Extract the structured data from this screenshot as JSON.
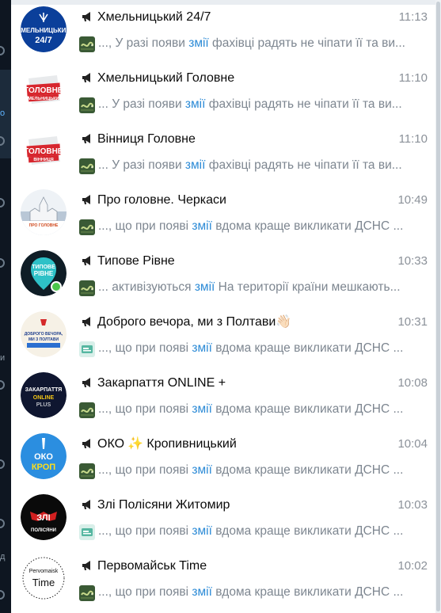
{
  "left_nav": {
    "fragments": [
      "o",
      "и",
      "д"
    ]
  },
  "chats": [
    {
      "title": "Хмельницький 24/7",
      "time": "11:13",
      "pre": "..., У разі появи ",
      "hl": "змії",
      "post": " фахівці радять не чіпати її та ви...",
      "avatar": "khm247",
      "avatar_text_1": "ХМЕЛЬНИЦЬКИЙ",
      "avatar_text_2": "24/7",
      "thumb": "snake"
    },
    {
      "title": "Хмельницький Головне",
      "time": "11:10",
      "pre": "... У разі появи ",
      "hl": "змії",
      "post": " фахівці радять не чіпати її та ви...",
      "avatar": "golovne-khm",
      "avatar_text_1": "ГОЛОВНЕ",
      "avatar_text_2": "ХМЕЛЬНИЦЬКИЙ",
      "thumb": "snake"
    },
    {
      "title": "Вінниця Головне",
      "time": "11:10",
      "pre": "... У разі появи ",
      "hl": "змії",
      "post": " фахівці радять не чіпати її та ви...",
      "avatar": "golovne-vin",
      "avatar_text_1": "ГОЛОВНЕ",
      "avatar_text_2": "ВІННИЦЯ",
      "thumb": "snake"
    },
    {
      "title": "Про головне. Черкаси",
      "time": "10:49",
      "pre": "..., що при появі ",
      "hl": "змії",
      "post": " вдома краще викликати ДСНС ...",
      "avatar": "cherkasy",
      "avatar_text_1": "ПРО ГОЛОВНЕ",
      "avatar_text_2": "",
      "thumb": "snake"
    },
    {
      "title": "Типове Рівне",
      "time": "10:33",
      "pre": "... активізуються ",
      "hl": "змії",
      "post": "  На території країни мешкають...",
      "avatar": "rivne",
      "avatar_text_1": "ТИПОВЕ",
      "avatar_text_2": "РІВНЕ",
      "thumb": "snake"
    },
    {
      "title": "Доброго вечора, ми з Полтави",
      "title_emoji": "👋🏻",
      "time": "10:31",
      "pre": "..., що при появі ",
      "hl": "змії",
      "post": " вдома краще викликати ДСНС ...",
      "avatar": "poltava",
      "avatar_text_1": "ДОБРОГО ВЕЧОРА,",
      "avatar_text_2": "МИ З ПОЛТАВИ",
      "thumb": "card"
    },
    {
      "title": "Закарпаття ONLINE +",
      "time": "10:08",
      "pre": "..., що при появі ",
      "hl": "змії",
      "post": " вдома краще викликати ДСНС ...",
      "avatar": "zakarpattia",
      "avatar_text_1": "ЗАКАРПАТТЯ",
      "avatar_text_2": "ONLINE",
      "avatar_text_3": "PLUS",
      "thumb": "snake"
    },
    {
      "title": "ОКО",
      "title_emoji": "✨",
      "title_rest": " Кропивницький",
      "time": "10:04",
      "pre": "..., що при появі ",
      "hl": "змії",
      "post": " вдома краще викликати ДСНС ...",
      "avatar": "oko",
      "avatar_text_1": "ОКО",
      "avatar_text_2": "КРОП",
      "thumb": "snake"
    },
    {
      "title": "Злі Полісяни Житомир",
      "time": "10:03",
      "pre": "..., що при появі ",
      "hl": "змії",
      "post": " вдома краще викликати ДСНС ...",
      "avatar": "zli",
      "avatar_text_1": "ЗЛІ",
      "avatar_text_2": "ПОЛІСЯНИ",
      "thumb": "card"
    },
    {
      "title": "Первомайськ Time",
      "time": "10:02",
      "pre": "..., що при появі ",
      "hl": "змії",
      "post": " вдома краще викликати ДСНС ...",
      "avatar": "pervomaisk",
      "avatar_text_1": "Pervomaisk",
      "avatar_text_2": "Time",
      "thumb": "snake"
    }
  ]
}
